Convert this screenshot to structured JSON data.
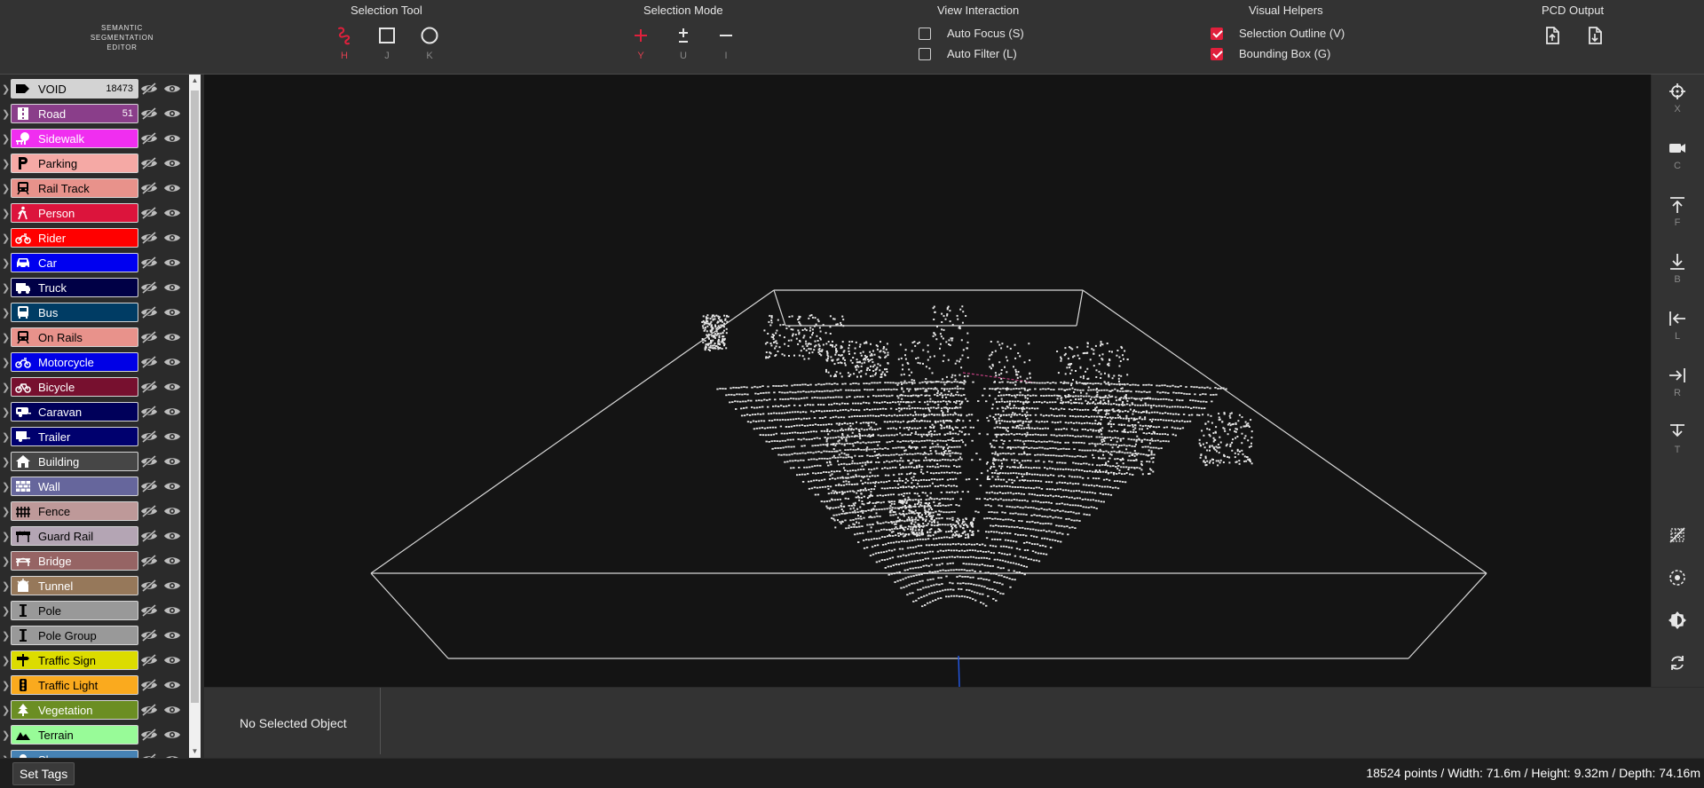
{
  "app": {
    "logo": [
      "SEMANTIC",
      "SEGMENTATION",
      "EDITOR"
    ]
  },
  "toolbar": {
    "selection_tool": {
      "title": "Selection Tool",
      "buttons": [
        {
          "name": "lasso",
          "key": "H",
          "active": true
        },
        {
          "name": "rectangle",
          "key": "J",
          "active": false
        },
        {
          "name": "circle",
          "key": "K",
          "active": false
        }
      ]
    },
    "selection_mode": {
      "title": "Selection Mode",
      "buttons": [
        {
          "name": "add",
          "key": "Y",
          "active": true
        },
        {
          "name": "toggle",
          "key": "U",
          "active": false
        },
        {
          "name": "subtract",
          "key": "I",
          "active": false
        }
      ]
    },
    "view_interaction": {
      "title": "View Interaction",
      "options": [
        {
          "label": "Auto Focus (S)",
          "checked": false
        },
        {
          "label": "Auto Filter (L)",
          "checked": false
        }
      ]
    },
    "visual_helpers": {
      "title": "Visual Helpers",
      "options": [
        {
          "label": "Selection Outline (V)",
          "checked": true
        },
        {
          "label": "Bounding Box (G)",
          "checked": true
        }
      ]
    },
    "pcd_output": {
      "title": "PCD Output",
      "icons": [
        "file-export-icon",
        "file-download-icon"
      ]
    }
  },
  "classes": [
    {
      "name": "VOID",
      "count": "18473",
      "color": "#d3d3d3",
      "text": "#000000",
      "icon": "tag-icon"
    },
    {
      "name": "Road",
      "count": "51",
      "color": "#8a3e8a",
      "text": "#ffffff",
      "icon": "road-icon"
    },
    {
      "name": "Sidewalk",
      "count": "",
      "color": "#f02ef0",
      "text": "#ffffff",
      "icon": "tree-bench-icon"
    },
    {
      "name": "Parking",
      "count": "",
      "color": "#f5a9a5",
      "text": "#000000",
      "icon": "parking-icon"
    },
    {
      "name": "Rail Track",
      "count": "",
      "color": "#e8928b",
      "text": "#000000",
      "icon": "train-icon"
    },
    {
      "name": "Person",
      "count": "",
      "color": "#dc143c",
      "text": "#ffffff",
      "icon": "walking-icon"
    },
    {
      "name": "Rider",
      "count": "",
      "color": "#ff0000",
      "text": "#ffffff",
      "icon": "motorcycle-icon"
    },
    {
      "name": "Car",
      "count": "",
      "color": "#0000f0",
      "text": "#ffffff",
      "icon": "car-icon"
    },
    {
      "name": "Truck",
      "count": "",
      "color": "#000046",
      "text": "#ffffff",
      "icon": "truck-icon"
    },
    {
      "name": "Bus",
      "count": "",
      "color": "#003c64",
      "text": "#ffffff",
      "icon": "bus-icon"
    },
    {
      "name": "On Rails",
      "count": "",
      "color": "#e8928b",
      "text": "#000000",
      "icon": "train-icon"
    },
    {
      "name": "Motorcycle",
      "count": "",
      "color": "#0000e6",
      "text": "#ffffff",
      "icon": "motorcycle-icon"
    },
    {
      "name": "Bicycle",
      "count": "",
      "color": "#77102f",
      "text": "#ffffff",
      "icon": "bicycle-icon"
    },
    {
      "name": "Caravan",
      "count": "",
      "color": "#00005a",
      "text": "#ffffff",
      "icon": "caravan-icon"
    },
    {
      "name": "Trailer",
      "count": "",
      "color": "#00006e",
      "text": "#ffffff",
      "icon": "trailer-icon"
    },
    {
      "name": "Building",
      "count": "",
      "color": "#464646",
      "text": "#ffffff",
      "icon": "home-icon"
    },
    {
      "name": "Wall",
      "count": "",
      "color": "#66669c",
      "text": "#ffffff",
      "icon": "brick-wall-icon"
    },
    {
      "name": "Fence",
      "count": "",
      "color": "#be9999",
      "text": "#000000",
      "icon": "fence-icon"
    },
    {
      "name": "Guard Rail",
      "count": "",
      "color": "#b4a5b4",
      "text": "#000000",
      "icon": "guard-rail-icon"
    },
    {
      "name": "Bridge",
      "count": "",
      "color": "#966464",
      "text": "#ffffff",
      "icon": "bridge-icon"
    },
    {
      "name": "Tunnel",
      "count": "",
      "color": "#96785a",
      "text": "#ffffff",
      "icon": "tunnel-light-icon"
    },
    {
      "name": "Pole",
      "count": "",
      "color": "#999999",
      "text": "#000000",
      "icon": "pole-icon"
    },
    {
      "name": "Pole Group",
      "count": "",
      "color": "#999999",
      "text": "#000000",
      "icon": "pole-icon"
    },
    {
      "name": "Traffic Sign",
      "count": "",
      "color": "#dcdc00",
      "text": "#000000",
      "icon": "sign-icon"
    },
    {
      "name": "Traffic Light",
      "count": "",
      "color": "#faaa1e",
      "text": "#000000",
      "icon": "traffic-light-icon"
    },
    {
      "name": "Vegetation",
      "count": "",
      "color": "#6b8e23",
      "text": "#ffffff",
      "icon": "tree-icon"
    },
    {
      "name": "Terrain",
      "count": "",
      "color": "#98fb98",
      "text": "#000000",
      "icon": "mountain-icon"
    },
    {
      "name": "Sky",
      "count": "",
      "color": "#4682b4",
      "text": "#ffffff",
      "icon": "cloud-icon"
    }
  ],
  "right_toolbar": [
    {
      "name": "crosshair-icon",
      "key": "X"
    },
    {
      "name": "camera-icon",
      "key": "C"
    },
    {
      "name": "view-front-icon",
      "key": "F"
    },
    {
      "name": "view-back-icon",
      "key": "B"
    },
    {
      "name": "view-left-icon",
      "key": "L"
    },
    {
      "name": "view-right-icon",
      "key": "R"
    },
    {
      "name": "view-top-icon",
      "key": "T"
    },
    {
      "name": "grid-toggle-icon",
      "key": ""
    },
    {
      "name": "point-size-icon",
      "key": ""
    },
    {
      "name": "brightness-icon",
      "key": ""
    },
    {
      "name": "reset-icon",
      "key": ""
    }
  ],
  "info_panel": {
    "selected_object": "No Selected Object"
  },
  "bottom_bar": {
    "set_tags": "Set Tags",
    "status": "18524 points / Width: 71.6m / Height: 9.32m / Depth: 74.16m"
  },
  "colors": {
    "accent": "#e0203c",
    "viewport_bg": "#141414",
    "panel_bg": "#333333"
  }
}
